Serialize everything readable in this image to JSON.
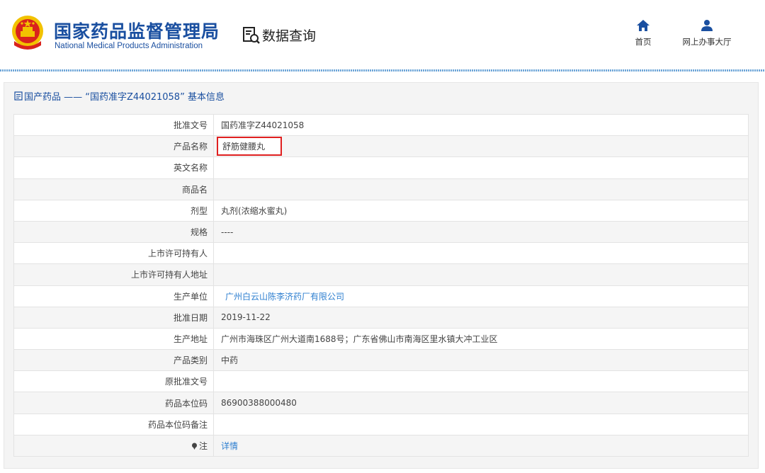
{
  "header": {
    "agency_cn": "国家药品监督管理局",
    "agency_en": "National Medical Products Administration",
    "section_title": "数据查询",
    "nav": [
      {
        "label": "首页",
        "icon": "home-icon"
      },
      {
        "label": "网上办事大厅",
        "icon": "user-icon"
      }
    ]
  },
  "panel": {
    "title": "国产药品 —— “国药准字Z44021058” 基本信息"
  },
  "record": [
    {
      "label": "批准文号",
      "value": "国药准字Z44021058"
    },
    {
      "label": "产品名称",
      "value": "舒筋健腰丸",
      "highlighted": true
    },
    {
      "label": "英文名称",
      "value": ""
    },
    {
      "label": "商品名",
      "value": ""
    },
    {
      "label": "剂型",
      "value": "丸剂(浓缩水蜜丸)"
    },
    {
      "label": "规格",
      "value": "----"
    },
    {
      "label": "上市许可持有人",
      "value": ""
    },
    {
      "label": "上市许可持有人地址",
      "value": ""
    },
    {
      "label": "生产单位",
      "value": "广州白云山陈李济药厂有限公司",
      "link": true
    },
    {
      "label": "批准日期",
      "value": "2019-11-22"
    },
    {
      "label": "生产地址",
      "value": "广州市海珠区广州大道南1688号；广东省佛山市南海区里水镇大冲工业区"
    },
    {
      "label": "产品类别",
      "value": "中药"
    },
    {
      "label": "原批准文号",
      "value": ""
    },
    {
      "label": "药品本位码",
      "value": "86900388000480"
    },
    {
      "label": "药品本位码备注",
      "value": ""
    },
    {
      "label": "注",
      "value": "详情",
      "link": true,
      "icon": "pin-icon"
    }
  ],
  "colors": {
    "brand_blue": "#1a4fa0",
    "link_blue": "#2e7fd0",
    "highlight_red": "#e02020"
  }
}
